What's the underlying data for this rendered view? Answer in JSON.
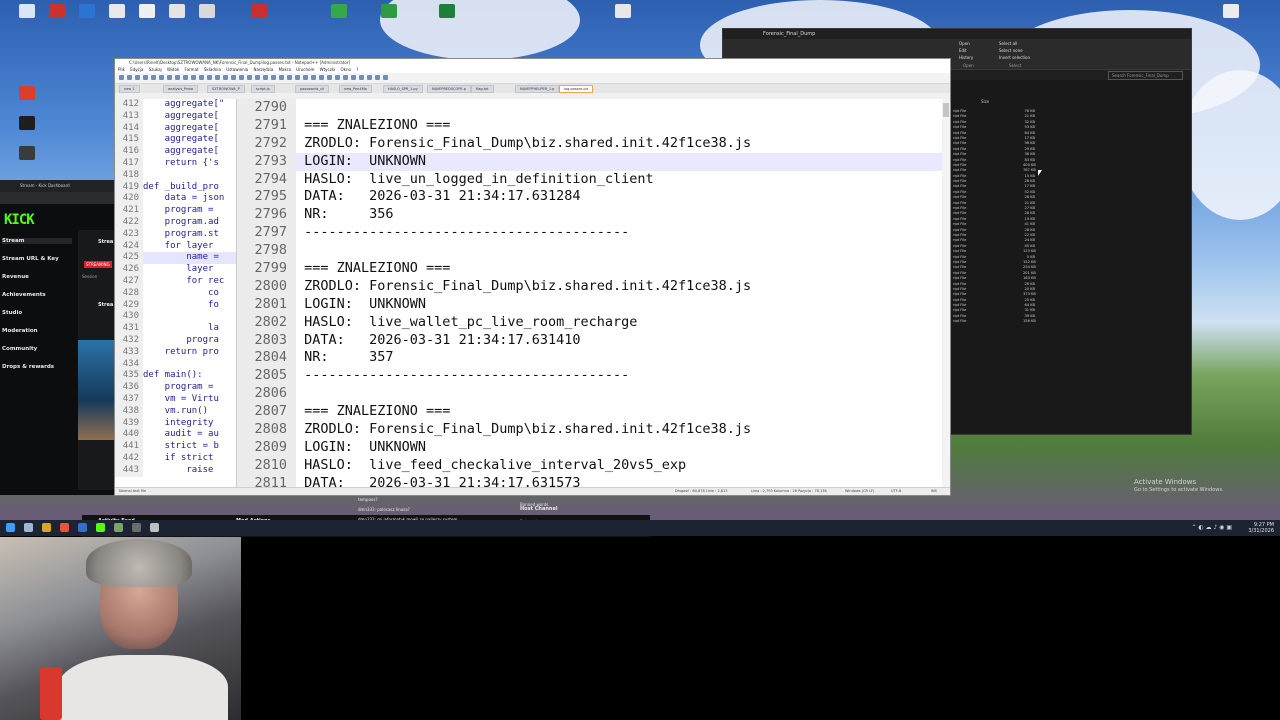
{
  "notepad": {
    "title": "C:\\Users\\Rinelt\\Desktop\\SZTROWOWANA_NK\\Forensic_Final_Dump\\log.passes.txt - Notepad++ [Administrator]",
    "menu": "Plik Edycja Szukaj Widok Format Składnia Ustawienia Narzędzia Makra Uruchom Wtyczki Okno ?",
    "tabs": [
      "new 1",
      "analysis_Proto",
      "SZTROWOWA_P",
      "script.js",
      "passwords_cli",
      "new_Pen4Ma",
      "HASLO_SPR_1.py",
      "NAVEPREDSCOPE.p",
      "flag.txt",
      "NAVEPFHELPER_1.p",
      "log.passes.txt"
    ],
    "left_lines": [
      {
        "n": "412",
        "t": "    aggregate[\""
      },
      {
        "n": "413",
        "t": "    aggregate["
      },
      {
        "n": "414",
        "t": "    aggregate["
      },
      {
        "n": "415",
        "t": "    aggregate["
      },
      {
        "n": "416",
        "t": "    aggregate["
      },
      {
        "n": "417",
        "t": "    return {'s"
      },
      {
        "n": "418",
        "t": ""
      },
      {
        "n": "419",
        "t": "def _build_pro"
      },
      {
        "n": "420",
        "t": "    data = json"
      },
      {
        "n": "421",
        "t": "    program = "
      },
      {
        "n": "422",
        "t": "    program.ad"
      },
      {
        "n": "423",
        "t": "    program.st"
      },
      {
        "n": "424",
        "t": "    for layer "
      },
      {
        "n": "425",
        "t": "        name = "
      },
      {
        "n": "426",
        "t": "        layer "
      },
      {
        "n": "427",
        "t": "        for rec"
      },
      {
        "n": "428",
        "t": "            co"
      },
      {
        "n": "429",
        "t": "            fo"
      },
      {
        "n": "430",
        "t": ""
      },
      {
        "n": "431",
        "t": "            la"
      },
      {
        "n": "432",
        "t": "        progra"
      },
      {
        "n": "433",
        "t": "    return pro"
      },
      {
        "n": "434",
        "t": ""
      },
      {
        "n": "435",
        "t": "def main():"
      },
      {
        "n": "436",
        "t": "    program = "
      },
      {
        "n": "437",
        "t": "    vm = Virtu"
      },
      {
        "n": "438",
        "t": "    vm.run()"
      },
      {
        "n": "439",
        "t": "    integrity "
      },
      {
        "n": "440",
        "t": "    audit = au"
      },
      {
        "n": "441",
        "t": "    strict = b"
      },
      {
        "n": "442",
        "t": "    if strict "
      },
      {
        "n": "443",
        "t": "        raise "
      }
    ],
    "right_lines": [
      {
        "n": "2790",
        "t": ""
      },
      {
        "n": "2791",
        "t": "=== ZNALEZIONO ==="
      },
      {
        "n": "2792",
        "t": "ZRODLO: Forensic_Final_Dump\\biz.shared.init.42f1ce38.js"
      },
      {
        "n": "2793",
        "t": "LOGIN:  UNKNOWN"
      },
      {
        "n": "2794",
        "t": "HASLO:  live_un_logged_in_definition_client"
      },
      {
        "n": "2795",
        "t": "DATA:   2026-03-31 21:34:17.631284"
      },
      {
        "n": "2796",
        "t": "NR:     356"
      },
      {
        "n": "2797",
        "t": "----------------------------------------"
      },
      {
        "n": "2798",
        "t": ""
      },
      {
        "n": "2799",
        "t": "=== ZNALEZIONO ==="
      },
      {
        "n": "2800",
        "t": "ZRODLO: Forensic_Final_Dump\\biz.shared.init.42f1ce38.js"
      },
      {
        "n": "2801",
        "t": "LOGIN:  UNKNOWN"
      },
      {
        "n": "2802",
        "t": "HASLO:  live_wallet_pc_live_room_recharge"
      },
      {
        "n": "2803",
        "t": "DATA:   2026-03-31 21:34:17.631410"
      },
      {
        "n": "2804",
        "t": "NR:     357"
      },
      {
        "n": "2805",
        "t": "----------------------------------------"
      },
      {
        "n": "2806",
        "t": ""
      },
      {
        "n": "2807",
        "t": "=== ZNALEZIONO ==="
      },
      {
        "n": "2808",
        "t": "ZRODLO: Forensic_Final_Dump\\biz.shared.init.42f1ce38.js"
      },
      {
        "n": "2809",
        "t": "LOGIN:  UNKNOWN"
      },
      {
        "n": "2810",
        "t": "HASLO:  live_feed_checkalive_interval_20vs5_exp"
      },
      {
        "n": "2811",
        "t": "DATA:   2026-03-31 21:34:17.631573"
      }
    ],
    "status": {
      "left": "Normal text file",
      "length": "Długość : 80,878   Linie : 2,813",
      "pos": "Linia : 2,793    Kolumna : 16    Pozycja : 78,136",
      "eol": "Windows (CR LF)",
      "enc": "UTF-8",
      "mode": "INS"
    }
  },
  "explorer": {
    "title": "Forensic_Final_Dump",
    "ribbon": {
      "open": "Open",
      "edit": "Edit",
      "history": "History",
      "select_all": "Select all",
      "select_none": "Select none",
      "invert": "Invert selection",
      "group_open": "Open",
      "group_select": "Select"
    },
    "search_placeholder": "Search Forensic_Final_Dump",
    "size_header": "Size",
    "files": [
      {
        "type": "ript File",
        "size": "76 KB"
      },
      {
        "type": "ript File",
        "size": "21 KB"
      },
      {
        "type": "ript File",
        "size": "32 KB"
      },
      {
        "type": "ript File",
        "size": "93 KB"
      },
      {
        "type": "ript File",
        "size": "64 KB"
      },
      {
        "type": "ript File",
        "size": "17 KB"
      },
      {
        "type": "ript File",
        "size": "98 KB"
      },
      {
        "type": "ript File",
        "size": "29 KB"
      },
      {
        "type": "ript File",
        "size": "36 KB"
      },
      {
        "type": "ript File",
        "size": "83 KB"
      },
      {
        "type": "ript File",
        "size": "400 KB"
      },
      {
        "type": "ript File",
        "size": "787 KB"
      },
      {
        "type": "ript File",
        "size": "15 KB"
      },
      {
        "type": "ript File",
        "size": "28 KB"
      },
      {
        "type": "ript File",
        "size": "17 KB"
      },
      {
        "type": "ript File",
        "size": "52 KB"
      },
      {
        "type": "ript File",
        "size": "28 KB"
      },
      {
        "type": "ript File",
        "size": "21 KB"
      },
      {
        "type": "ript File",
        "size": "27 KB"
      },
      {
        "type": "ript File",
        "size": "28 KB"
      },
      {
        "type": "ript File",
        "size": "19 KB"
      },
      {
        "type": "ript File",
        "size": "41 KB"
      },
      {
        "type": "ript File",
        "size": "28 KB"
      },
      {
        "type": "ript File",
        "size": "22 KB"
      },
      {
        "type": "ript File",
        "size": "24 KB"
      },
      {
        "type": "ript File",
        "size": "45 KB"
      },
      {
        "type": "ript File",
        "size": "123 KB"
      },
      {
        "type": "ript File",
        "size": "5 KB"
      },
      {
        "type": "ript File",
        "size": "152 KB"
      },
      {
        "type": "ript File",
        "size": "234 KB"
      },
      {
        "type": "ript File",
        "size": "201 KB"
      },
      {
        "type": "ript File",
        "size": "163 KB"
      },
      {
        "type": "ript File",
        "size": "26 KB"
      },
      {
        "type": "ript File",
        "size": "20 KB"
      },
      {
        "type": "ript File",
        "size": "373 KB"
      },
      {
        "type": "ript File",
        "size": "25 KB"
      },
      {
        "type": "ript File",
        "size": "64 KB"
      },
      {
        "type": "ript File",
        "size": "31 KB"
      },
      {
        "type": "ript File",
        "size": "39 KB"
      },
      {
        "type": "ript File",
        "size": "156 KB"
      }
    ]
  },
  "kick": {
    "tab_label": "Stream - Kick Dashboard",
    "logo": "KICK",
    "nav": [
      "Stream",
      "Stream URL & Key",
      "Revenue",
      "Achievements",
      "Studio",
      "Moderation",
      "Community",
      "Drops & rewards"
    ],
    "session": "Session",
    "streaming_badge": "STREAMING",
    "stream_label": "Strea"
  },
  "chat": {
    "activity_feed": "Activity Feed",
    "mod_actions": "Mod Actions",
    "messages": [
      "tempoos?",
      "dmn333: polecasz linusa?",
      "dmn333: mi informatyk mowil ze najleszy system",
      "oldsoft: dzieki pohelembam 100%"
    ],
    "host_channel": "Host Channel",
    "bot_goals": "Bot goals",
    "banned_words": "Banned words"
  },
  "taskbar": {
    "time": "9:27 PM",
    "date": "3/31/2026"
  },
  "watermark": {
    "line1": "Activate Windows",
    "line2": "Go to Settings to activate Windows."
  }
}
